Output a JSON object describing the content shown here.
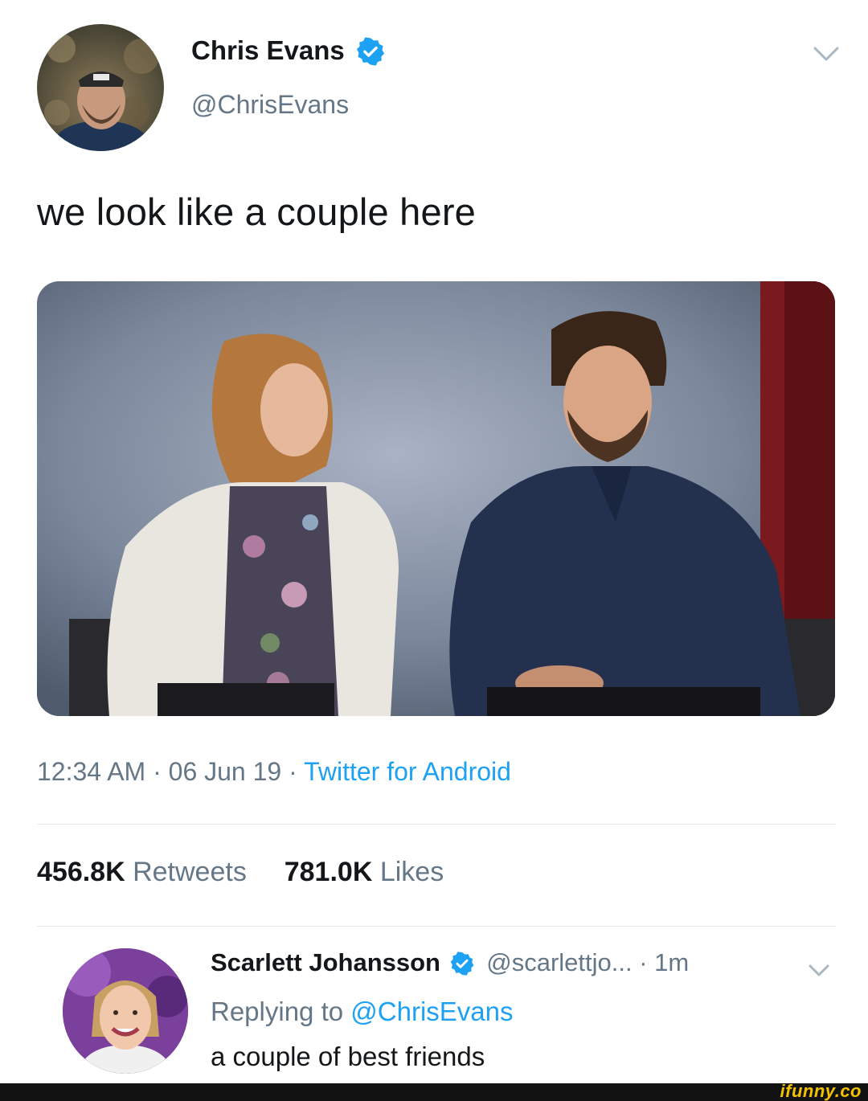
{
  "tweet": {
    "author_name": "Chris Evans",
    "author_handle": "@ChrisEvans",
    "text": "we look like a couple here",
    "time": "12:34 AM",
    "date": "06 Jun 19",
    "source": "Twitter for Android",
    "retweets_count": "456.8K",
    "retweets_label": "Retweets",
    "likes_count": "781.0K",
    "likes_label": "Likes",
    "separator": "·"
  },
  "reply": {
    "author_name": "Scarlett Johansson",
    "author_handle": "@scarlettjo...",
    "time_ago": "· 1m",
    "replying_label": "Replying to",
    "replying_to": "@ChrisEvans",
    "text": "a couple of best friends"
  },
  "watermark": "ifunny.co",
  "icons": {
    "verified": "verified-badge-icon",
    "menu": "chevron-down-icon"
  },
  "colors": {
    "accent": "#1da1f2",
    "secondary_text": "#657786",
    "primary_text": "#14171a"
  }
}
